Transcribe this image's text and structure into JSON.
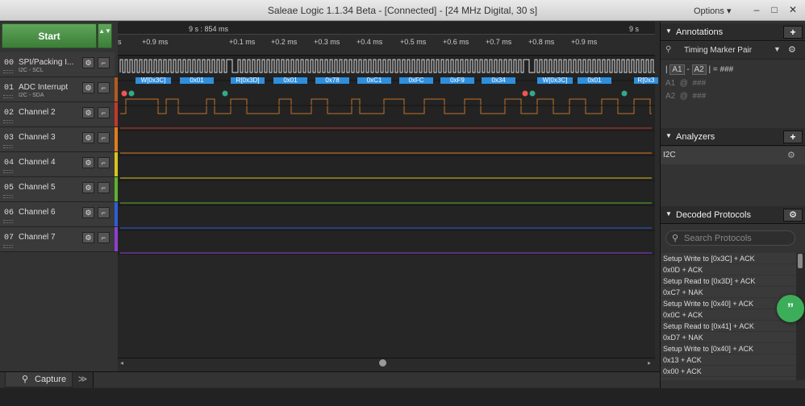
{
  "window": {
    "title": "Saleae Logic 1.1.34 Beta - [Connected] - [24 MHz Digital, 30 s]",
    "options": "Options ▾",
    "minimize": "–",
    "maximize": "□",
    "close": "✕"
  },
  "start": {
    "label": "Start",
    "arrows": "▲▼"
  },
  "channels": [
    {
      "num": "00",
      "name": "SPI/Packing I...",
      "sub": "I2C - SCL",
      "color": "#333333"
    },
    {
      "num": "01",
      "name": "ADC Interrupt",
      "sub": "I2C - SDA",
      "color": "#b45a1e"
    },
    {
      "num": "02",
      "name": "Channel 2",
      "sub": "",
      "color": "#c0392b"
    },
    {
      "num": "03",
      "name": "Channel 3",
      "sub": "",
      "color": "#e07b1e"
    },
    {
      "num": "04",
      "name": "Channel 4",
      "sub": "",
      "color": "#d8c31e"
    },
    {
      "num": "05",
      "name": "Channel 5",
      "sub": "",
      "color": "#5fb12c"
    },
    {
      "num": "06",
      "name": "Channel 6",
      "sub": "",
      "color": "#2d5fd6"
    },
    {
      "num": "07",
      "name": "Channel 7",
      "sub": "",
      "color": "#8e3fd1"
    }
  ],
  "timeline": {
    "major_left": "9 s : 854 ms",
    "major_right": "9 s",
    "ticks": [
      "s",
      "+0.9 ms",
      "+0.1 ms",
      "+0.2 ms",
      "+0.3 ms",
      "+0.4 ms",
      "+0.5 ms",
      "+0.6 ms",
      "+0.7 ms",
      "+0.8 ms",
      "+0.9 ms"
    ]
  },
  "packets": [
    "W[0x3C]",
    "0x01",
    "R[0x3D]",
    "0x01",
    "0x78",
    "0xC1",
    "0xFC",
    "0xF9",
    "0x34",
    "W[0x3C]",
    "0x01",
    "R[0x3"
  ],
  "tabs": {
    "capture": "Capture",
    "expand": "≫"
  },
  "annotations": {
    "title": "Annotations",
    "add": "+",
    "marker": "Timing Marker Pair",
    "formula_a1": "A1",
    "formula_a2": "A2",
    "formula_value": "= ###",
    "a1_row": "A1  @  ###",
    "a2_row": "A2  @  ###"
  },
  "analyzers": {
    "title": "Analyzers",
    "add": "+",
    "items": [
      "I2C"
    ]
  },
  "decoded": {
    "title": "Decoded Protocols",
    "search_placeholder": "Search Protocols",
    "items": [
      "Setup Write to [0x3C] + ACK",
      "0x0D + ACK",
      "Setup Read to [0x3D] + ACK",
      "0xC7 + NAK",
      "Setup Write to [0x40] + ACK",
      "0x0C + ACK",
      "Setup Read to [0x41] + ACK",
      "0xD7 + NAK",
      "Setup Write to [0x40] + ACK",
      "0x13 + ACK",
      "0x00 + ACK"
    ]
  },
  "fab": {
    "label": "”"
  }
}
